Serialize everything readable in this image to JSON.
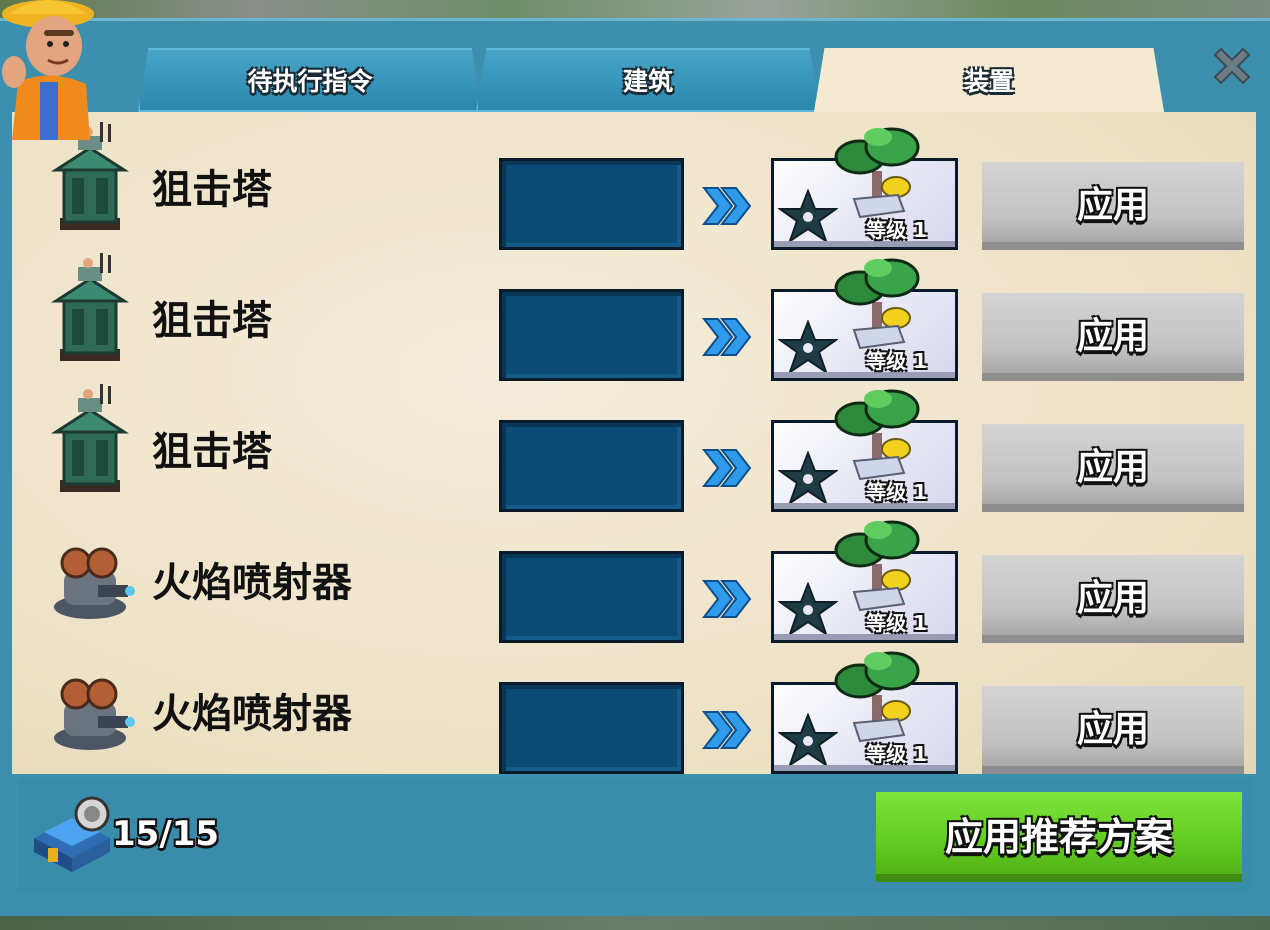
{
  "tabs": [
    {
      "label": "待执行指令",
      "active": false
    },
    {
      "label": "建筑",
      "active": false
    },
    {
      "label": "装置",
      "active": true
    }
  ],
  "rows": [
    {
      "name": "狙击塔",
      "icon": "sniper-tower-icon",
      "prototype_level": "等级 1",
      "apply_label": "应用"
    },
    {
      "name": "狙击塔",
      "icon": "sniper-tower-icon",
      "prototype_level": "等级 1",
      "apply_label": "应用"
    },
    {
      "name": "狙击塔",
      "icon": "sniper-tower-icon",
      "prototype_level": "等级 1",
      "apply_label": "应用"
    },
    {
      "name": "火焰喷射器",
      "icon": "flamethrower-icon",
      "prototype_level": "等级 1",
      "apply_label": "应用"
    },
    {
      "name": "火焰喷射器",
      "icon": "flamethrower-icon",
      "prototype_level": "等级 1",
      "apply_label": "应用"
    }
  ],
  "footer": {
    "inventory_count": "15/15",
    "recommend_label": "应用推荐方案"
  },
  "colors": {
    "frame": "#3d8fae",
    "panel": "#f3ead1",
    "slot": "#0c4b75",
    "apply_gray": "#c2c2c2",
    "recommend_green": "#62cc22",
    "arrow_blue": "#2f9bea"
  }
}
